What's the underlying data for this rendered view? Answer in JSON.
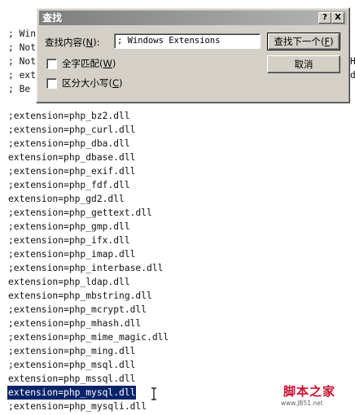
{
  "dialog": {
    "title": "查找",
    "help_button": "?",
    "close_button": "X",
    "find_label": "查找内容",
    "find_hotkey": "N",
    "find_value": "; Windows Extensions",
    "match_word_label": "全字匹配",
    "match_word_hotkey": "W",
    "match_case_label": "区分大小写",
    "match_case_hotkey": "C",
    "find_next_label": "查找下一个",
    "find_next_hotkey": "F",
    "cancel_label": "取消"
  },
  "editor": {
    "hidden_lines": [
      "; Win",
      "; Not",
      "; Not",
      "; ext",
      "; Be "
    ],
    "lines": [
      ";extension=php_bz2.dll",
      ";extension=php_curl.dll",
      ";extension=php_dba.dll",
      "extension=php_dbase.dll",
      ";extension=php_exif.dll",
      ";extension=php_fdf.dll",
      "extension=php_gd2.dll",
      ";extension=php_gettext.dll",
      ";extension=php_gmp.dll",
      ";extension=php_ifx.dll",
      ";extension=php_imap.dll",
      ";extension=php_interbase.dll",
      "extension=php_ldap.dll",
      "extension=php_mbstring.dll",
      ";extension=php_mcrypt.dll",
      ";extension=php_mhash.dll",
      ";extension=php_mime_magic.dll",
      ";extension=php_ming.dll",
      ";extension=php_msql.dll",
      "extension=php_mssql.dll",
      "extension=php_mysql.dll",
      ";extension=php_mysqli.dll"
    ],
    "selected_index": 20
  },
  "watermark": {
    "title": "脚本之家",
    "url": "www.JB51.net"
  }
}
